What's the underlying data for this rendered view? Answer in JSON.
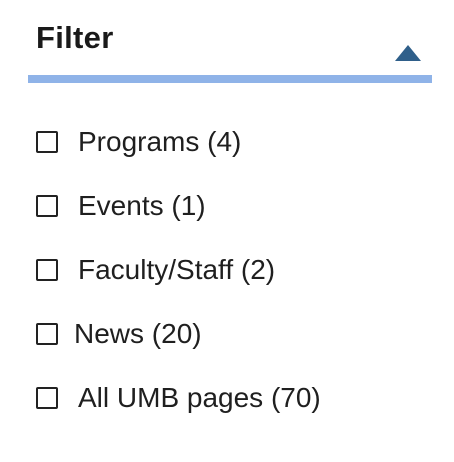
{
  "filter": {
    "title": "Filter",
    "toggle_icon": "triangle-up-icon",
    "accent_color": "#8fb3e8",
    "icon_color": "#2f5f8a",
    "options": [
      {
        "label": "Programs (4)",
        "checked": false
      },
      {
        "label": "Events (1)",
        "checked": false
      },
      {
        "label": "Faculty/Staff (2)",
        "checked": false
      },
      {
        "label": "News (20)",
        "checked": false
      },
      {
        "label": "All UMB pages (70)",
        "checked": false
      }
    ]
  }
}
